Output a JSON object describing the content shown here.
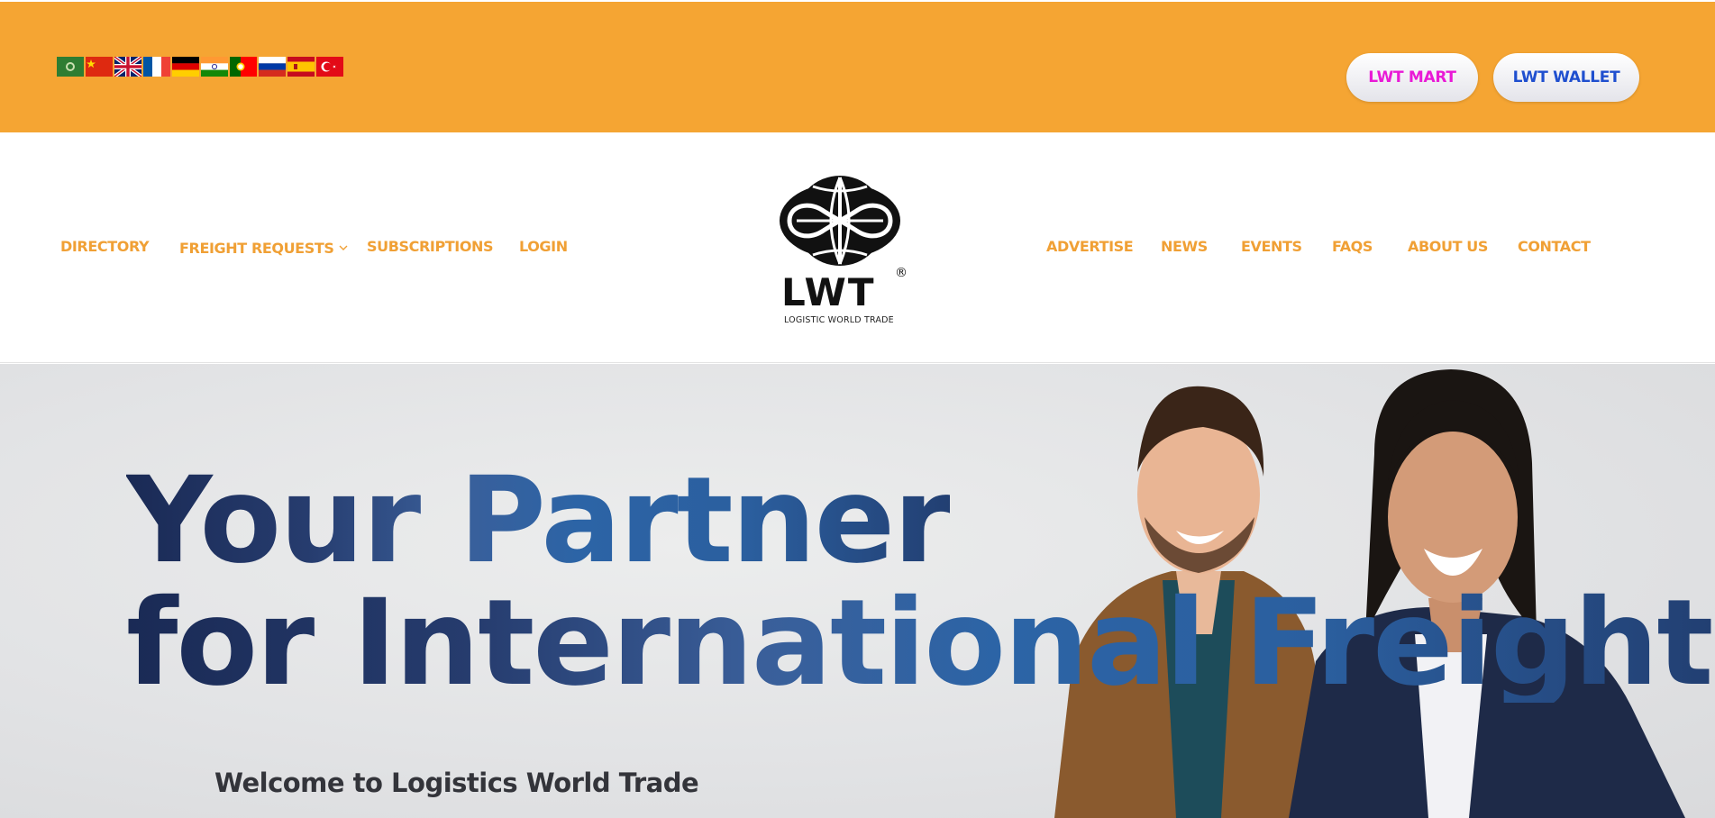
{
  "topbar": {
    "flags": [
      "Arabic",
      "Chinese",
      "English",
      "French",
      "German",
      "Hindi",
      "Portuguese",
      "Russian",
      "Spanish",
      "Turkish"
    ],
    "mart_label": "LWT MART",
    "wallet_label": "LWT WALLET"
  },
  "nav": {
    "left": [
      "DIRECTORY",
      "FREIGHT REQUESTS",
      "SUBSCRIPTIONS",
      "LOGIN"
    ],
    "right": [
      "ADVERTISE",
      "NEWS",
      "EVENTS",
      "FAQS",
      "ABOUT US",
      "CONTACT"
    ]
  },
  "logo": {
    "text": "LWT",
    "registered": "®",
    "subtitle": "LOGISTIC WORLD TRADE"
  },
  "hero": {
    "headline_line1": "Your Partner",
    "headline_line2": "for International Freight",
    "welcome": "Welcome to Logistics World Trade"
  },
  "colors": {
    "topbar": "#f5a533",
    "nav_text": "#f0a035",
    "mart": "#e91ad6",
    "wallet": "#1f4fcf",
    "headline": "#2c64a6"
  }
}
